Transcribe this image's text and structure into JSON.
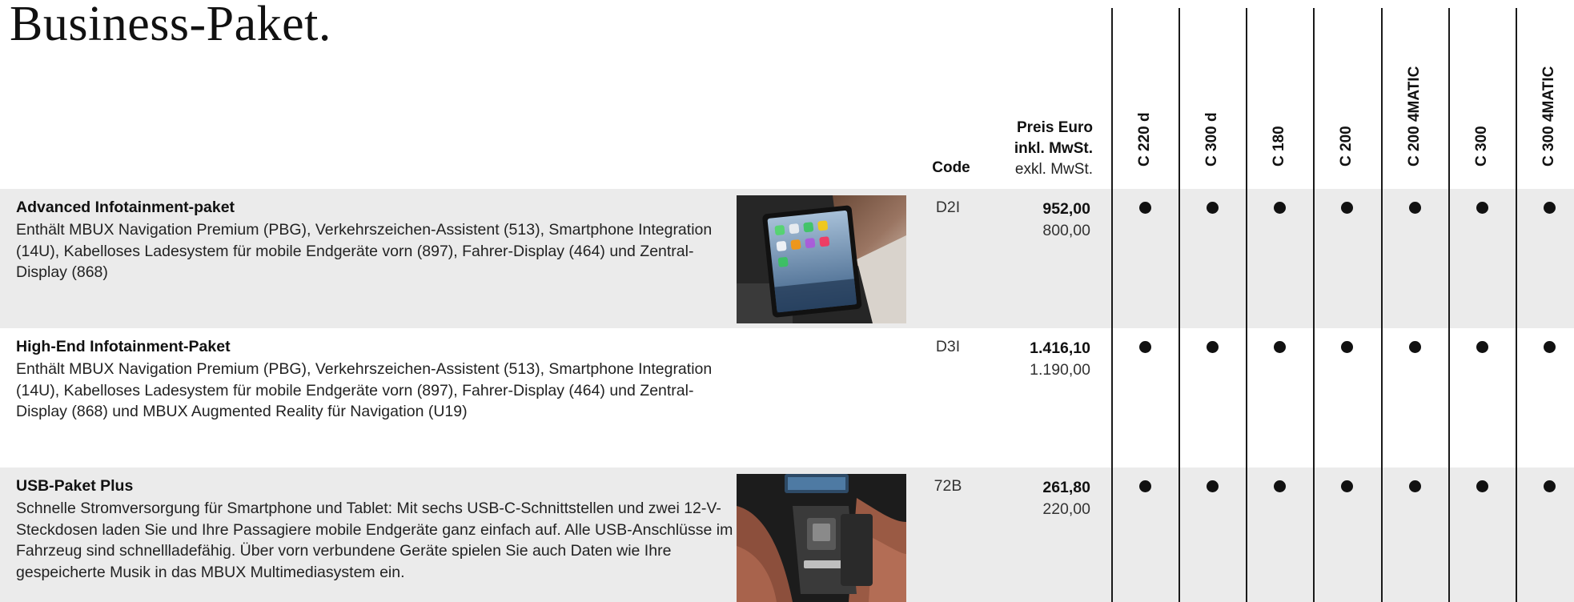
{
  "title": "Business-Paket.",
  "header": {
    "code_label": "Code",
    "price_gross_line1": "Preis Euro",
    "price_gross_line2": "inkl. MwSt.",
    "price_net_label": "exkl. MwSt."
  },
  "models": [
    "C 220 d",
    "C 300 d",
    "C 180",
    "C 200",
    "C 200 4MATIC",
    "C 300",
    "C 300 4MATIC"
  ],
  "rows": [
    {
      "title": "Advanced Infotainment-paket",
      "description": "Enthält MBUX Navigation Premium (PBG), Verkehrszeichen-Assistent (513), Smartphone Integration (14U), Kabelloses Ladesystem für mobile Endgeräte vorn (897), Fahrer-Display (464) und Zentral-Display (868)",
      "code": "D2I",
      "price_gross": "952,00",
      "price_net": "800,00",
      "availability": [
        "●",
        "●",
        "●",
        "●",
        "●",
        "●",
        "●"
      ],
      "shaded": true,
      "has_image": true
    },
    {
      "title": "High-End Infotainment-Paket",
      "description": "Enthält MBUX Navigation Premium (PBG), Verkehrszeichen-Assistent (513), Smartphone Integration (14U), Kabelloses Ladesystem für mobile Endgeräte vorn (897), Fahrer-Display (464) und Zentral-Display (868) und MBUX Augmented Reality für Navigation (U19)",
      "code": "D3I",
      "price_gross": "1.416,10",
      "price_net": "1.190,00",
      "availability": [
        "●",
        "●",
        "●",
        "●",
        "●",
        "●",
        "●"
      ],
      "shaded": false,
      "has_image": false
    },
    {
      "title": "USB-Paket Plus",
      "description": "Schnelle Stromversorgung für Smartphone und Tablet: Mit sechs USB-C-Schnittstellen und zwei 12-V-Steckdosen laden Sie und Ihre Passagiere mobile Endgeräte ganz einfach auf. Alle USB-Anschlüsse im Fahrzeug sind schnellladefähig. Über vorn verbundene Geräte spielen Sie auch Daten wie Ihre gespeicherte Musik in das MBUX Multimediasystem ein.",
      "code": "72B",
      "price_gross": "261,80",
      "price_net": "220,00",
      "availability": [
        "●",
        "●",
        "●",
        "●",
        "●",
        "●",
        "●"
      ],
      "shaded": true,
      "has_image": true
    }
  ]
}
